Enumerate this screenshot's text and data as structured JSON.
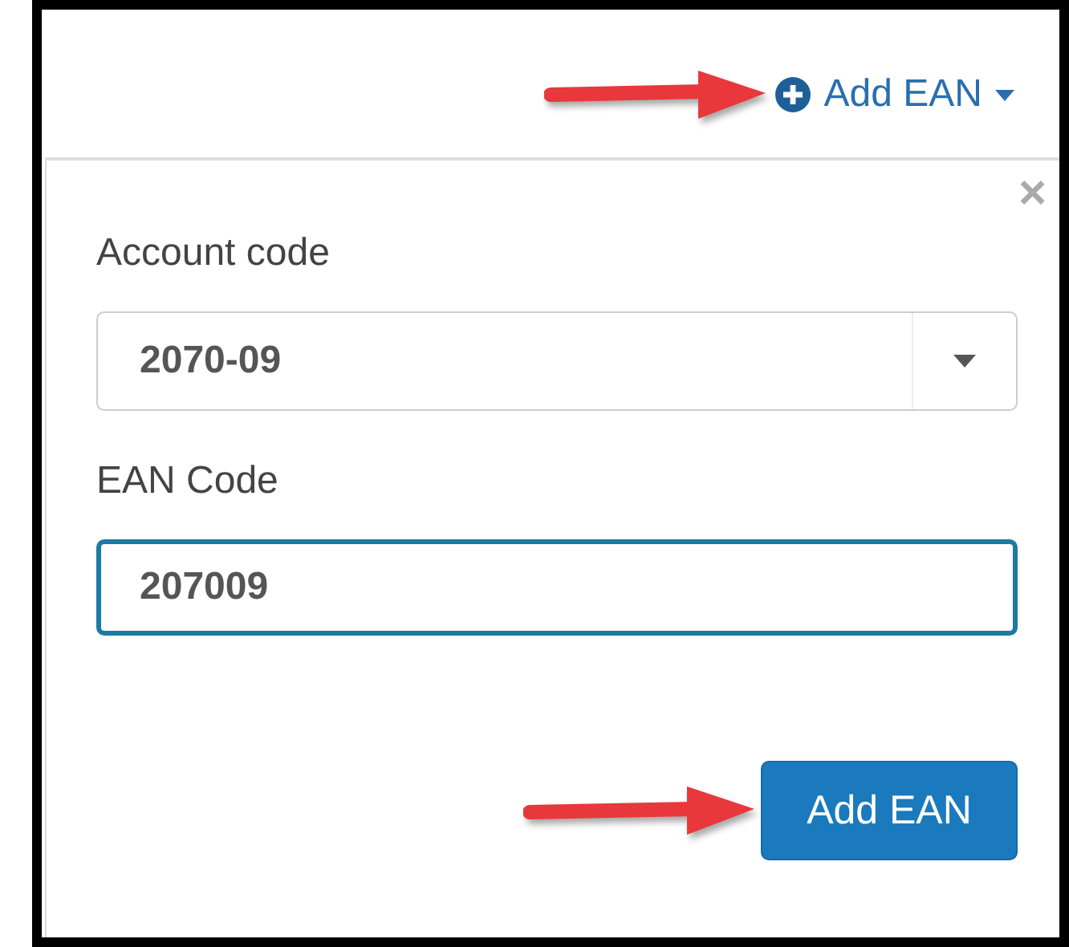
{
  "header": {
    "dropdown_label": "Add EAN"
  },
  "panel": {
    "close": "×",
    "account_code": {
      "label": "Account code",
      "value": "2070-09"
    },
    "ean_code": {
      "label": "EAN Code",
      "value": "207009",
      "focused": true
    },
    "submit": "Add EAN"
  }
}
